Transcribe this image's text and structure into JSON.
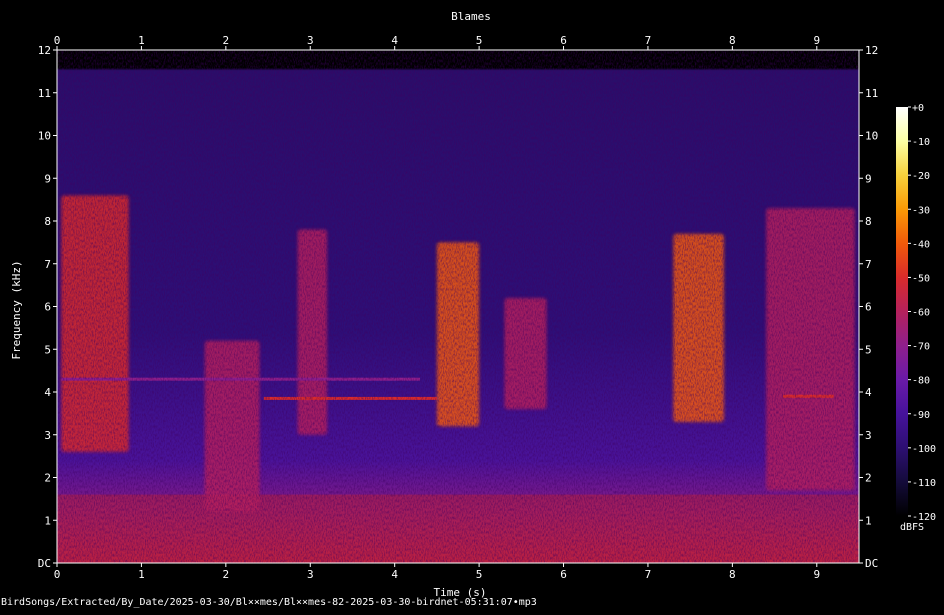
{
  "chart_data": {
    "type": "heatmap",
    "title": "Blames",
    "xlabel": "Time (s)",
    "ylabel": "Frequency (kHz)",
    "xlim": [
      0,
      9.5
    ],
    "ylim": [
      0,
      12
    ],
    "x_ticks": [
      "0",
      "1",
      "2",
      "3",
      "4",
      "5",
      "6",
      "7",
      "8",
      "9"
    ],
    "y_ticks": [
      "DC",
      "1",
      "2",
      "3",
      "4",
      "5",
      "6",
      "7",
      "8",
      "9",
      "10",
      "11",
      "12"
    ],
    "colorbar": {
      "label": "dBFS",
      "range": [
        -120,
        0
      ],
      "ticks": [
        "+0",
        "-10",
        "-20",
        "-30",
        "-40",
        "-50",
        "-60",
        "-70",
        "-80",
        "-90",
        "-100",
        "-110",
        "-120"
      ]
    },
    "calls": [
      {
        "t0": 0.05,
        "t1": 0.85,
        "f_lo": 2.6,
        "f_hi": 8.6,
        "level": -55
      },
      {
        "t0": 1.75,
        "t1": 2.4,
        "f_lo": 1.2,
        "f_hi": 5.2,
        "level": -60
      },
      {
        "t0": 2.85,
        "t1": 3.2,
        "f_lo": 3.0,
        "f_hi": 7.8,
        "level": -58
      },
      {
        "t0": 4.5,
        "t1": 5.0,
        "f_lo": 3.2,
        "f_hi": 7.5,
        "level": -45
      },
      {
        "t0": 5.3,
        "t1": 5.8,
        "f_lo": 3.6,
        "f_hi": 6.2,
        "level": -58
      },
      {
        "t0": 7.3,
        "t1": 7.9,
        "f_lo": 3.3,
        "f_hi": 7.7,
        "level": -42
      },
      {
        "t0": 8.4,
        "t1": 9.45,
        "f_lo": 1.7,
        "f_hi": 8.3,
        "level": -62
      }
    ],
    "tones": [
      {
        "t0": 0.05,
        "t1": 4.3,
        "f": 4.3,
        "level": -70
      },
      {
        "t0": 2.45,
        "t1": 4.5,
        "f": 3.85,
        "level": -55
      },
      {
        "t0": 8.6,
        "t1": 9.2,
        "f": 3.9,
        "level": -55
      }
    ]
  },
  "colors": {
    "background": "#000000",
    "text": "#ffffff",
    "colormap": [
      "#000000",
      "#140b3a",
      "#2d0f72",
      "#46129b",
      "#6a1aa8",
      "#8f1f8c",
      "#b5215c",
      "#d92b2b",
      "#f15a0a",
      "#fb9a06",
      "#f7d13c",
      "#fcffa4",
      "#ffffff"
    ]
  },
  "footer": {
    "file_path": "BirdSongs/Extracted/By_Date/2025-03-30/Bl××mes/Bl××mes-82-2025-03-30-birdnet-05:31:07•mp3"
  }
}
